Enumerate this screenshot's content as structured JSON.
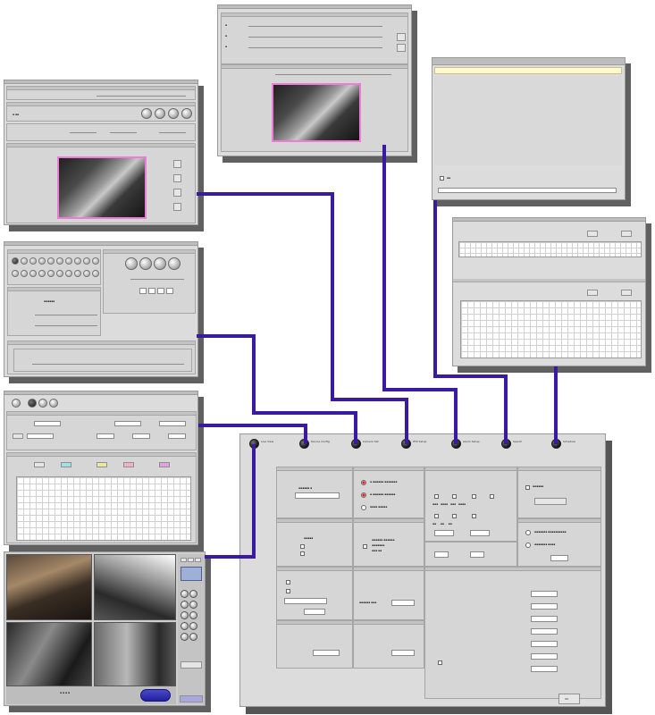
{
  "colors": {
    "connector": "#3a1aa0",
    "preview_border": "#f07cd8",
    "window_bg": "#dcdcdc",
    "shadow": "#606060"
  },
  "tabs": [
    {
      "label": "Live View"
    },
    {
      "label": "Device Config"
    },
    {
      "label": "Camera Set"
    },
    {
      "label": "PTZ Setup"
    },
    {
      "label": "Alarm Setup"
    },
    {
      "label": "Search"
    },
    {
      "label": "Schedule"
    }
  ],
  "footer": {
    "ok_label": "OK"
  },
  "connector_icon": "line-connector"
}
